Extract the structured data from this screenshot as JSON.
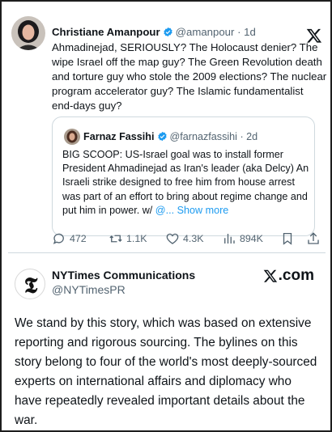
{
  "quoted_tweet": {
    "author": {
      "name": "Christiane Amanpour",
      "handle": "@amanpour",
      "time": "· 1d"
    },
    "text": "Ahmadinejad, SERIOUSLY? The Holocaust denier? The wipe Israel off the map guy? The Green Revolution death and torture guy who stole the 2009 elections? The nuclear program accelerator guy? The Islamic fundamentalist end-days guy?",
    "quote": {
      "author": {
        "name": "Farnaz Fassihi",
        "handle": "@farnazfassihi",
        "time": "· 2d"
      },
      "text": "BIG SCOOP: US-Israel goal was to install former President Ahmadinejad as Iran's leader (aka Delcy) An Israeli strike designed to free him from house arrest was part of an effort to bring about regime change and put him in power. w/ ",
      "mention_truncated": "@...",
      "show_more": "Show more"
    },
    "stats": {
      "replies": "472",
      "reposts": "1.1K",
      "likes": "4.3K",
      "views": "894K"
    },
    "icons": [
      "x-logo",
      "verified-badge",
      "reply-icon",
      "repost-icon",
      "like-icon",
      "views-icon",
      "bookmark-icon",
      "share-icon"
    ]
  },
  "post": {
    "author": {
      "name": "NYTimes Communications",
      "handle": "@NYTimesPR"
    },
    "source_label": ".com",
    "text": "We stand by this story, which was based on extensive reporting and rigorous sourcing. The bylines on this story belong to four of the world's most deeply-sourced experts on international affairs and diplomacy who have repeatedly revealed important details about the war."
  },
  "colors": {
    "verified": "#1d9bf0",
    "secondary_text": "#536471",
    "link": "#1d9bf0",
    "border": "#cfd9de"
  }
}
